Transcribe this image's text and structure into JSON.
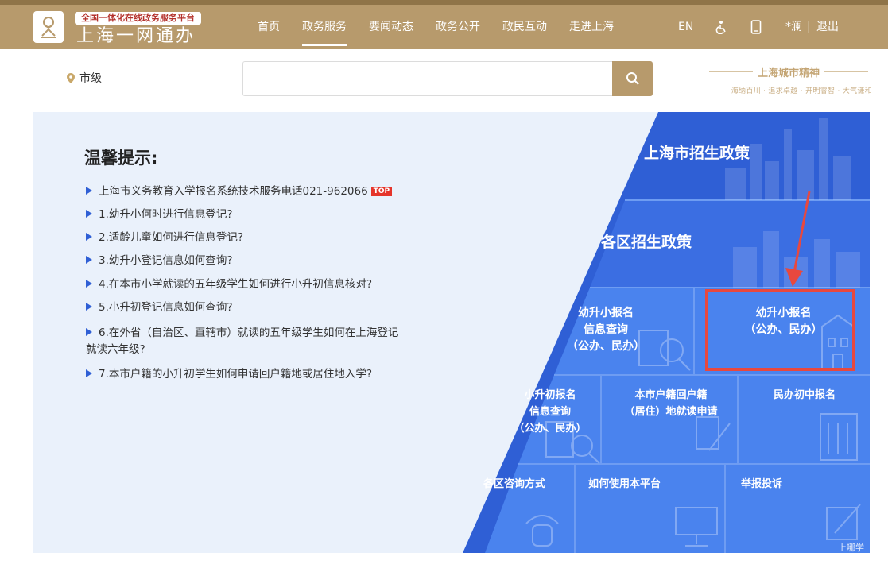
{
  "header": {
    "slogan": "全国一体化在线政务服务平台",
    "brand": "上海一网通办",
    "nav": [
      {
        "label": "首页",
        "active": false
      },
      {
        "label": "政务服务",
        "active": true
      },
      {
        "label": "要闻动态",
        "active": false
      },
      {
        "label": "政务公开",
        "active": false
      },
      {
        "label": "政民互动",
        "active": false
      },
      {
        "label": "走进上海",
        "active": false
      }
    ],
    "lang": "EN",
    "user": "*澜",
    "separator": "|",
    "logout": "退出"
  },
  "search": {
    "location": "市级",
    "placeholder": "",
    "spirit_title": "上海城市精神",
    "spirit_sub": "海纳百川 · 追求卓越 · 开明睿智 · 大气谦和"
  },
  "tips": {
    "title": "温馨提示:",
    "items": [
      "上海市义务教育入学报名系统技术服务电话021-962066",
      "1.幼升小何时进行信息登记?",
      "2.适龄儿童如何进行信息登记?",
      "3.幼升小登记信息如何查询?",
      "4.在本市小学就读的五年级学生如何进行小升初信息核对?",
      "5.小升初登记信息如何查询?",
      "6.在外省（自治区、直辖市）就读的五年级学生如何在上海登记",
      "就读六年级?",
      "7.本市户籍的小升初学生如何申请回户籍地或居住地入学?"
    ],
    "top_badge": "TOP"
  },
  "tiles": {
    "city_policy": "上海市招生政策",
    "district_policy": "各区招生政策",
    "kg_query": [
      "幼升小报名",
      "信息查询",
      "（公办、民办）"
    ],
    "kg_register": [
      "幼升小报名",
      "（公办、民办）"
    ],
    "ps_query": [
      "小升初报名",
      "信息查询",
      "（公办、民办）"
    ],
    "hukou": [
      "本市户籍回户籍",
      "（居住）地就读申请"
    ],
    "private_ms": "民办初中报名",
    "district_contact": "各区咨询方式",
    "how_to_use": "如何使用本平台",
    "report": "举报投诉",
    "corner_text": "上哪学"
  },
  "colors": {
    "header_bg": "#b79a6c",
    "tile_dark": "#2f5fd5",
    "tile_light": "#4a83ee",
    "highlight": "#e8483e"
  }
}
